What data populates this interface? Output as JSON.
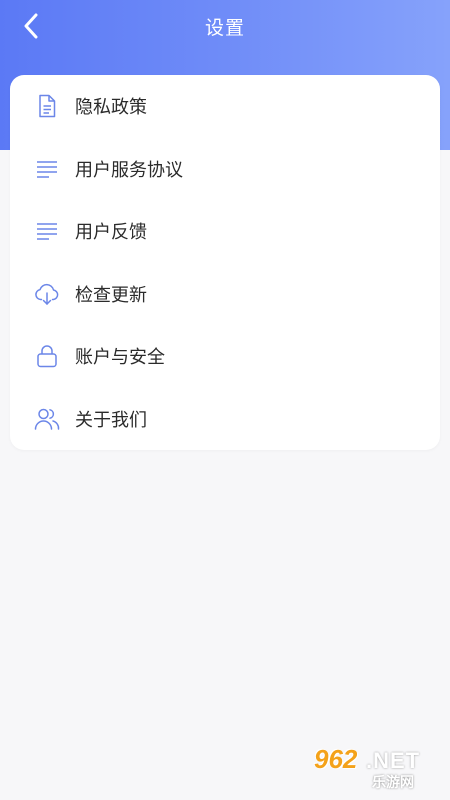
{
  "header": {
    "title": "设置",
    "back_icon": "chevron-left-icon",
    "gradient_colors": [
      "#5b79f5",
      "#86a2fb"
    ]
  },
  "menu": {
    "items": [
      {
        "label": "隐私政策",
        "icon": "document-icon"
      },
      {
        "label": "用户服务协议",
        "icon": "lines-icon"
      },
      {
        "label": "用户反馈",
        "icon": "lines-icon"
      },
      {
        "label": "检查更新",
        "icon": "cloud-download-icon"
      },
      {
        "label": "账户与安全",
        "icon": "lock-icon"
      },
      {
        "label": "关于我们",
        "icon": "users-icon"
      }
    ]
  },
  "watermark": {
    "number": "962",
    "suffix": ".NET",
    "subtitle": "乐游网"
  },
  "colors": {
    "accent": "#5b79f5",
    "icon": "#6b86e8",
    "text": "#2b2b2b",
    "background": "#f7f7f9"
  }
}
